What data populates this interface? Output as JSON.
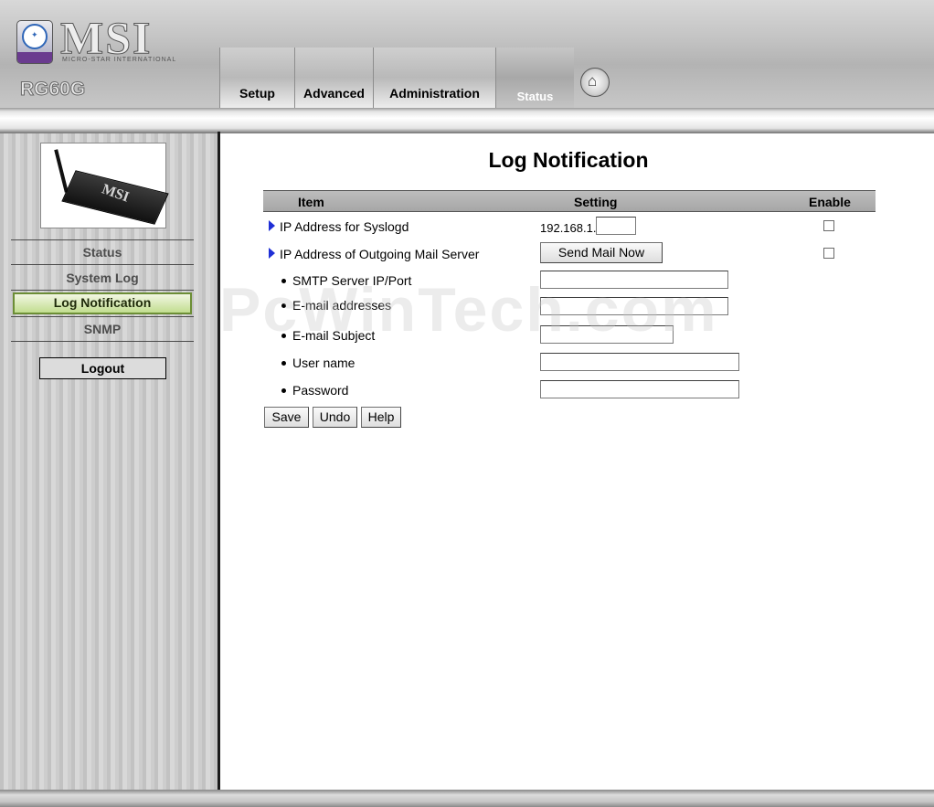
{
  "brand": {
    "logo_text": "MSI",
    "logo_sub": "MICRO-STAR INTERNATIONAL",
    "model": "RG60G"
  },
  "nav": {
    "tabs": [
      {
        "label": "Setup"
      },
      {
        "label": "Advanced"
      },
      {
        "label": "Administration"
      },
      {
        "label": "Status"
      }
    ],
    "active": "Status",
    "home_icon": "home-icon"
  },
  "sidebar": {
    "device_label": "MSI",
    "items": [
      {
        "label": "Status"
      },
      {
        "label": "System Log"
      },
      {
        "label": "Log Notification"
      },
      {
        "label": "SNMP"
      }
    ],
    "active": "Log Notification",
    "logout_label": "Logout",
    "accent_color": "#c1dd8f"
  },
  "main": {
    "title": "Log Notification",
    "table_headers": {
      "item": "Item",
      "setting": "Setting",
      "enable": "Enable"
    },
    "rows": {
      "syslogd": {
        "label": "IP Address for Syslogd",
        "ip_prefix": "192.168.1.",
        "value": "",
        "enabled": false
      },
      "mail_server": {
        "label": "IP Address of Outgoing Mail Server",
        "send_button": "Send Mail Now",
        "enabled": false
      },
      "smtp": {
        "label": "SMTP Server IP/Port",
        "value": ""
      },
      "email": {
        "label": "E-mail addresses",
        "value": ""
      },
      "subject": {
        "label": "E-mail Subject",
        "value": ""
      },
      "user": {
        "label": "User name",
        "value": ""
      },
      "password": {
        "label": "Password",
        "value": ""
      }
    },
    "buttons": {
      "save": "Save",
      "undo": "Undo",
      "help": "Help"
    }
  },
  "watermark": "PcWinTech.com"
}
